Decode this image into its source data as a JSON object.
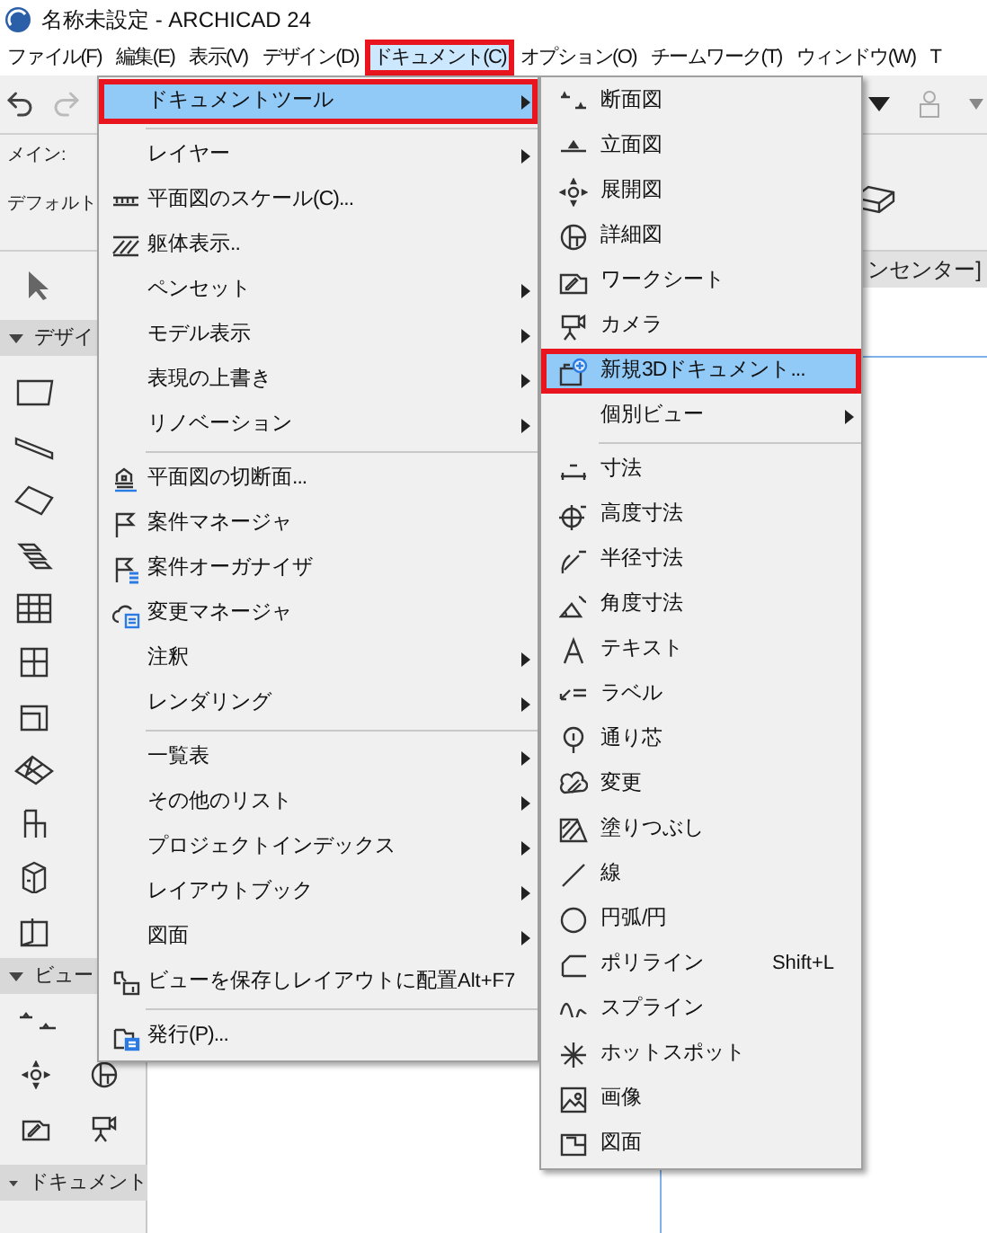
{
  "window": {
    "title": "名称未設定 - ARCHICAD 24"
  },
  "menu_bar": [
    {
      "label": "ファイル(F)",
      "selected": false
    },
    {
      "label": "編集(E)",
      "selected": false
    },
    {
      "label": "表示(V)",
      "selected": false
    },
    {
      "label": "デザイン(D)",
      "selected": false
    },
    {
      "label": "ドキュメント(C)",
      "selected": true,
      "highlighted": true
    },
    {
      "label": "オプション(O)",
      "selected": false
    },
    {
      "label": "チームワーク(T)",
      "selected": false
    },
    {
      "label": "ウィンドウ(W)",
      "selected": false
    },
    {
      "label": "T",
      "selected": false
    }
  ],
  "info_box": {
    "label": "メイン:",
    "value": "デフォルト"
  },
  "view_tab": {
    "label": "ンセンター]"
  },
  "toolbox": {
    "sections": [
      {
        "label": "デザイ",
        "expanded": true
      },
      {
        "label": "ビュー",
        "expanded": true
      },
      {
        "label": "ドキュメント",
        "expanded": true
      }
    ]
  },
  "document_menu": {
    "items": [
      {
        "kind": "item",
        "label": "ドキュメントツール",
        "submenu": true,
        "selected": true,
        "highlighted": true
      },
      {
        "kind": "separator"
      },
      {
        "kind": "item",
        "label": "レイヤー",
        "submenu": true,
        "selected": false
      },
      {
        "kind": "item",
        "label": "平面図のスケール(C)...",
        "submenu": false,
        "selected": false
      },
      {
        "kind": "item",
        "label": "躯体表示..",
        "submenu": false,
        "selected": false
      },
      {
        "kind": "item",
        "label": "ペンセット",
        "submenu": true,
        "selected": false
      },
      {
        "kind": "item",
        "label": "モデル表示",
        "submenu": true,
        "selected": false
      },
      {
        "kind": "item",
        "label": "表現の上書き",
        "submenu": true,
        "selected": false
      },
      {
        "kind": "item",
        "label": "リノベーション",
        "submenu": true,
        "selected": false
      },
      {
        "kind": "separator"
      },
      {
        "kind": "item",
        "label": "平面図の切断面...",
        "submenu": false,
        "selected": false
      },
      {
        "kind": "item",
        "label": "案件マネージャ",
        "submenu": false,
        "selected": false
      },
      {
        "kind": "item",
        "label": "案件オーガナイザ",
        "submenu": false,
        "selected": false
      },
      {
        "kind": "item",
        "label": "変更マネージャ",
        "submenu": false,
        "selected": false
      },
      {
        "kind": "item",
        "label": "注釈",
        "submenu": true,
        "selected": false
      },
      {
        "kind": "item",
        "label": "レンダリング",
        "submenu": true,
        "selected": false
      },
      {
        "kind": "separator"
      },
      {
        "kind": "item",
        "label": "一覧表",
        "submenu": true,
        "selected": false
      },
      {
        "kind": "item",
        "label": "その他のリスト",
        "submenu": true,
        "selected": false
      },
      {
        "kind": "item",
        "label": "プロジェクトインデックス",
        "submenu": true,
        "selected": false
      },
      {
        "kind": "item",
        "label": "レイアウトブック",
        "submenu": true,
        "selected": false
      },
      {
        "kind": "item",
        "label": "図面",
        "submenu": true,
        "selected": false
      },
      {
        "kind": "item",
        "label": "ビューを保存しレイアウトに配置",
        "submenu": false,
        "selected": false,
        "shortcut": "Alt+F7"
      },
      {
        "kind": "separator"
      },
      {
        "kind": "item",
        "label": "発行(P)...",
        "submenu": false,
        "selected": false
      }
    ]
  },
  "document_tools_submenu": {
    "items": [
      {
        "kind": "item",
        "label": "断面図",
        "submenu": false,
        "selected": false
      },
      {
        "kind": "item",
        "label": "立面図",
        "submenu": false,
        "selected": false
      },
      {
        "kind": "item",
        "label": "展開図",
        "submenu": false,
        "selected": false
      },
      {
        "kind": "item",
        "label": "詳細図",
        "submenu": false,
        "selected": false
      },
      {
        "kind": "item",
        "label": "ワークシート",
        "submenu": false,
        "selected": false
      },
      {
        "kind": "item",
        "label": "カメラ",
        "submenu": false,
        "selected": false
      },
      {
        "kind": "item",
        "label": "新規3Dドキュメント...",
        "submenu": false,
        "selected": true,
        "highlighted": true
      },
      {
        "kind": "item",
        "label": "個別ビュー",
        "submenu": true,
        "selected": false
      },
      {
        "kind": "separator"
      },
      {
        "kind": "item",
        "label": "寸法",
        "submenu": false,
        "selected": false
      },
      {
        "kind": "item",
        "label": "高度寸法",
        "submenu": false,
        "selected": false
      },
      {
        "kind": "item",
        "label": "半径寸法",
        "submenu": false,
        "selected": false
      },
      {
        "kind": "item",
        "label": "角度寸法",
        "submenu": false,
        "selected": false
      },
      {
        "kind": "item",
        "label": "テキスト",
        "submenu": false,
        "selected": false
      },
      {
        "kind": "item",
        "label": "ラベル",
        "submenu": false,
        "selected": false
      },
      {
        "kind": "item",
        "label": "通り芯",
        "submenu": false,
        "selected": false
      },
      {
        "kind": "item",
        "label": "変更",
        "submenu": false,
        "selected": false
      },
      {
        "kind": "item",
        "label": "塗りつぶし",
        "submenu": false,
        "selected": false
      },
      {
        "kind": "item",
        "label": "線",
        "submenu": false,
        "selected": false
      },
      {
        "kind": "item",
        "label": "円弧/円",
        "submenu": false,
        "selected": false
      },
      {
        "kind": "item",
        "label": "ポリライン",
        "submenu": false,
        "selected": false,
        "shortcut": "Shift+L"
      },
      {
        "kind": "item",
        "label": "スプライン",
        "submenu": false,
        "selected": false
      },
      {
        "kind": "item",
        "label": "ホットスポット",
        "submenu": false,
        "selected": false
      },
      {
        "kind": "item",
        "label": "画像",
        "submenu": false,
        "selected": false
      },
      {
        "kind": "item",
        "label": "図面",
        "submenu": false,
        "selected": false
      }
    ]
  }
}
